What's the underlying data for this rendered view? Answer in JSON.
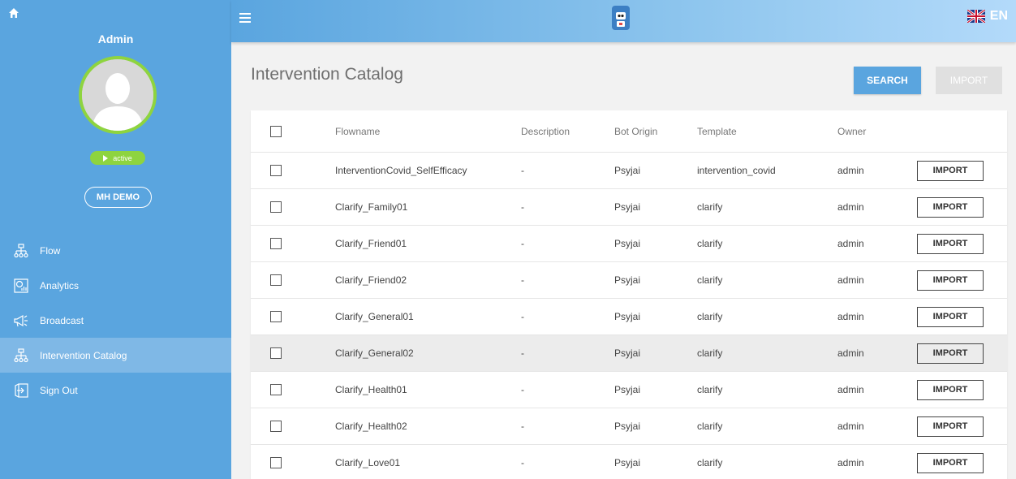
{
  "sidebar": {
    "user_name": "Admin",
    "status_label": "active",
    "workspace_label": "MH DEMO",
    "items": [
      {
        "label": "Flow",
        "icon": "flow-icon",
        "active": false
      },
      {
        "label": "Analytics",
        "icon": "analytics-icon",
        "active": false
      },
      {
        "label": "Broadcast",
        "icon": "broadcast-icon",
        "active": false
      },
      {
        "label": "Intervention Catalog",
        "icon": "catalog-icon",
        "active": true
      },
      {
        "label": "Sign Out",
        "icon": "sign-out-icon",
        "active": false
      }
    ]
  },
  "topbar": {
    "language": "EN"
  },
  "main": {
    "title": "Intervention Catalog",
    "search_label": "SEARCH",
    "import_label": "IMPORT"
  },
  "table": {
    "columns": [
      "Flowname",
      "Description",
      "Bot Origin",
      "Template",
      "Owner"
    ],
    "row_action_label": "IMPORT",
    "rows": [
      {
        "flowname": "InterventionCovid_SelfEfficacy",
        "description": "-",
        "bot_origin": "Psyjai",
        "template": "intervention_covid",
        "owner": "admin"
      },
      {
        "flowname": "Clarify_Family01",
        "description": "-",
        "bot_origin": "Psyjai",
        "template": "clarify",
        "owner": "admin"
      },
      {
        "flowname": "Clarify_Friend01",
        "description": "-",
        "bot_origin": "Psyjai",
        "template": "clarify",
        "owner": "admin"
      },
      {
        "flowname": "Clarify_Friend02",
        "description": "-",
        "bot_origin": "Psyjai",
        "template": "clarify",
        "owner": "admin"
      },
      {
        "flowname": "Clarify_General01",
        "description": "-",
        "bot_origin": "Psyjai",
        "template": "clarify",
        "owner": "admin"
      },
      {
        "flowname": "Clarify_General02",
        "description": "-",
        "bot_origin": "Psyjai",
        "template": "clarify",
        "owner": "admin"
      },
      {
        "flowname": "Clarify_Health01",
        "description": "-",
        "bot_origin": "Psyjai",
        "template": "clarify",
        "owner": "admin"
      },
      {
        "flowname": "Clarify_Health02",
        "description": "-",
        "bot_origin": "Psyjai",
        "template": "clarify",
        "owner": "admin"
      },
      {
        "flowname": "Clarify_Love01",
        "description": "-",
        "bot_origin": "Psyjai",
        "template": "clarify",
        "owner": "admin"
      }
    ]
  },
  "colors": {
    "sidebar": "#5aa5df",
    "accent": "#5aa5df",
    "status_green": "#8ed43f"
  }
}
